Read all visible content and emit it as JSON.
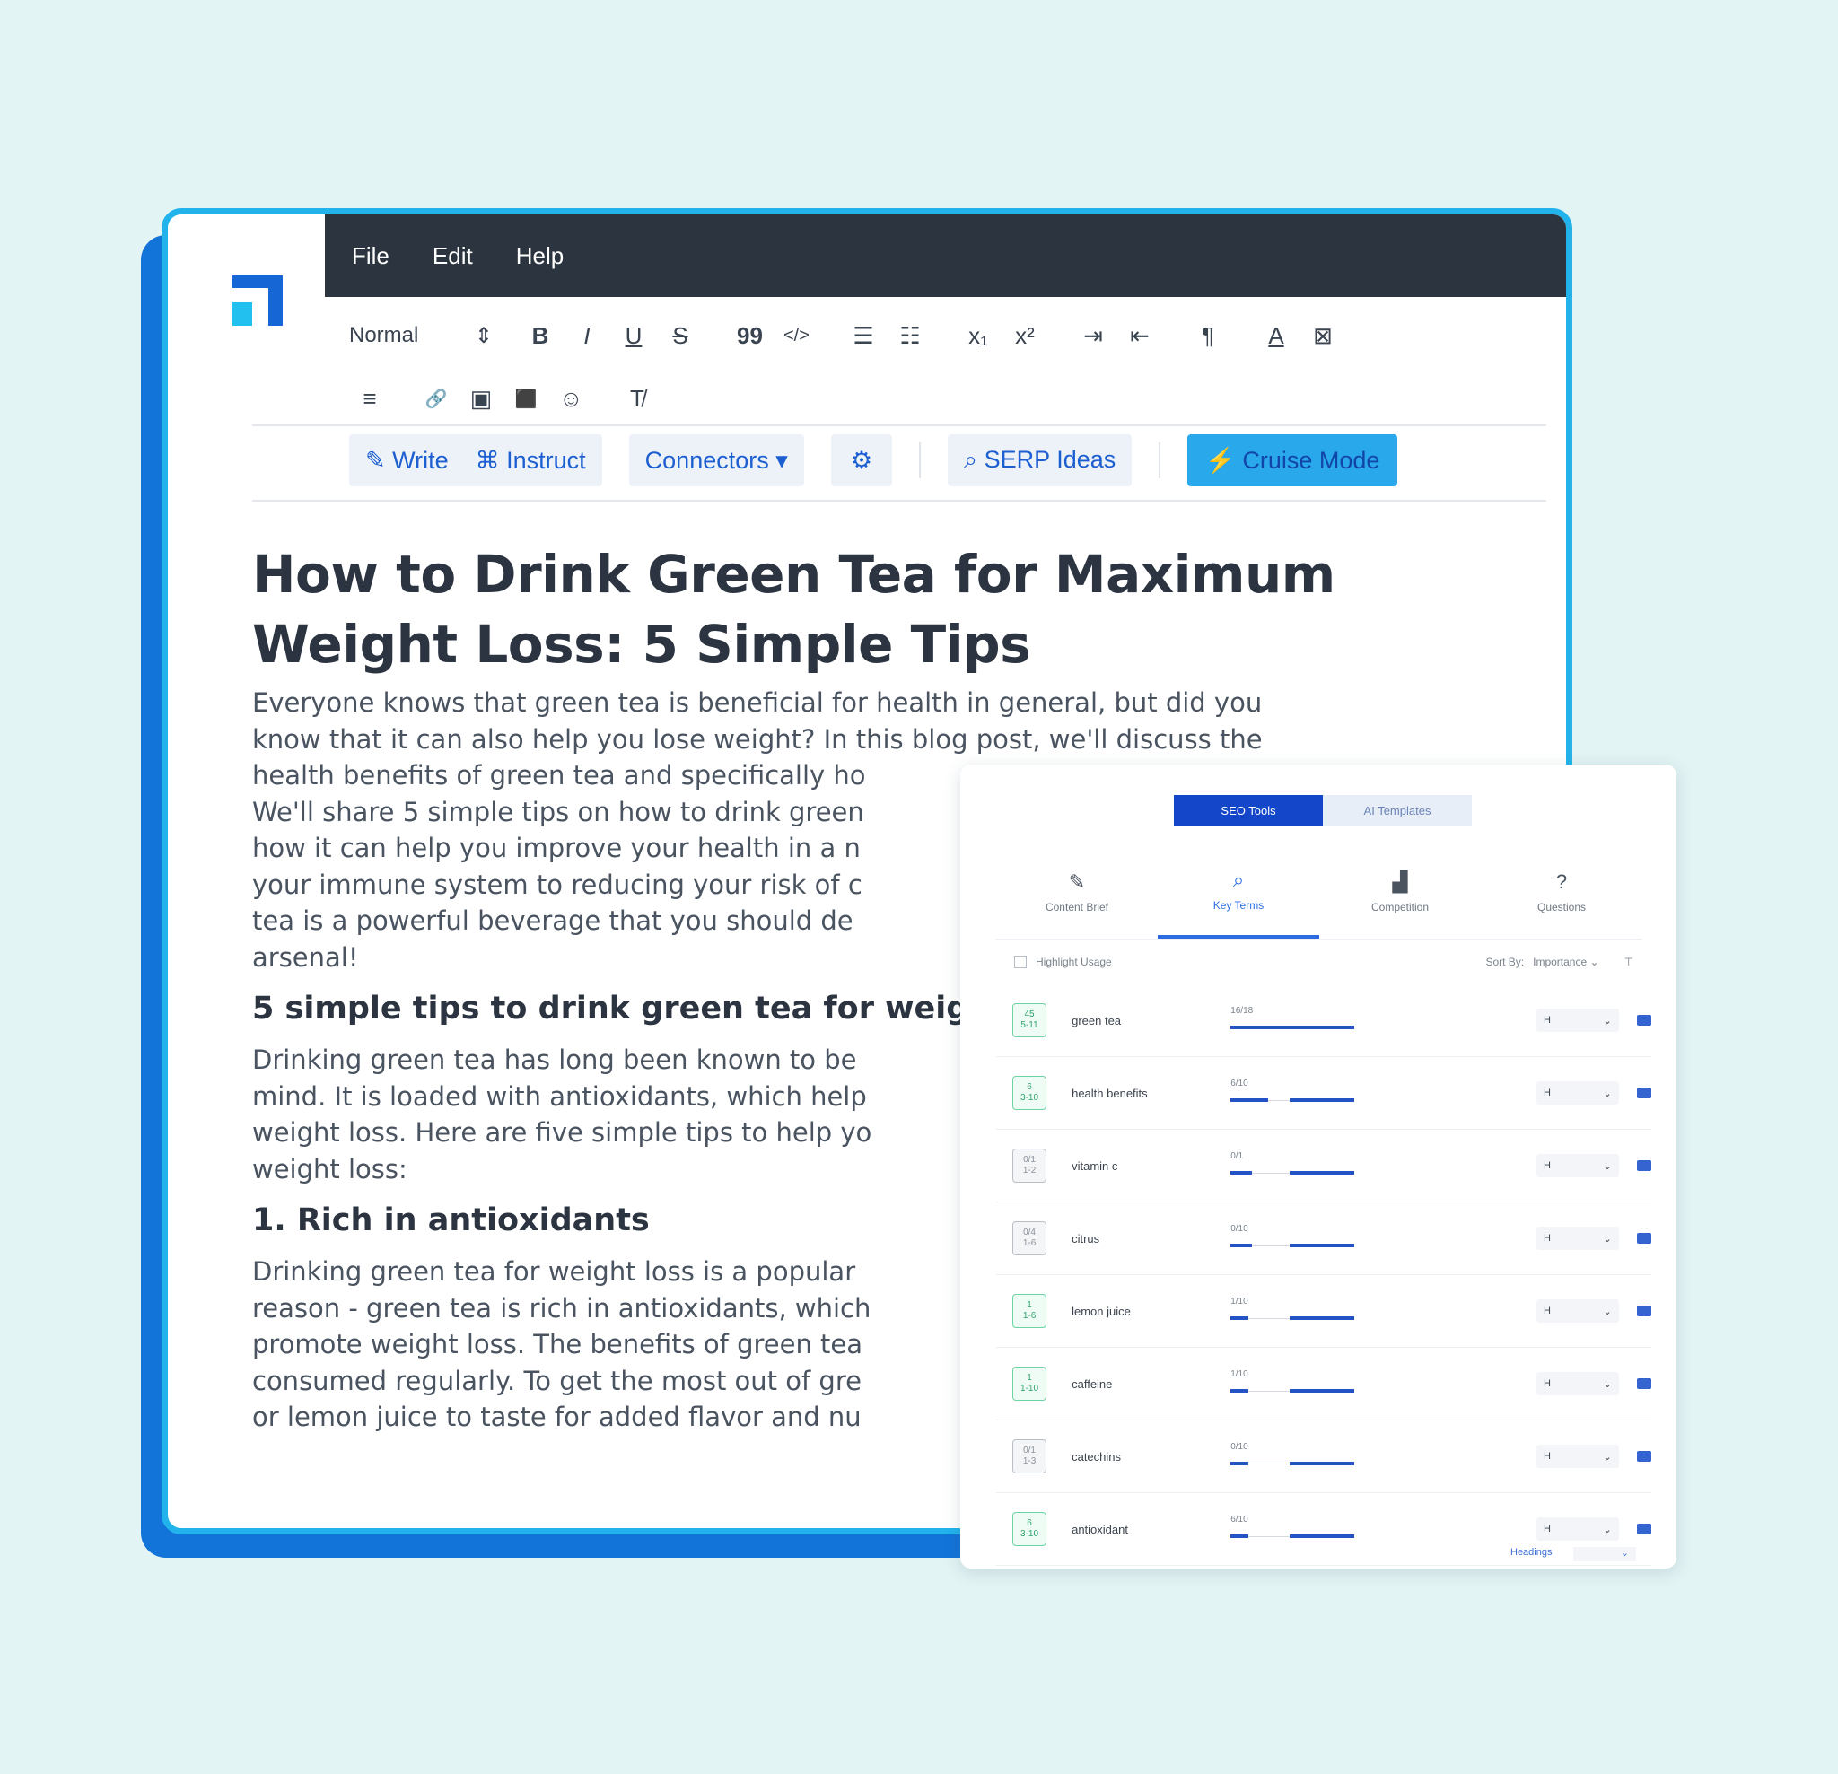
{
  "menu": [
    "File",
    "Edit",
    "Help"
  ],
  "toolbar": {
    "format_value": "Normal",
    "format_arrow": "⇕",
    "row1": [
      "B",
      "I",
      "U",
      "S",
      "99",
      "</>",
      "☰",
      "☷",
      "x₁",
      "x²",
      "⇥",
      "⇤",
      "¶",
      "A",
      "⊠"
    ],
    "row2": [
      "≡",
      "🔗",
      "▣",
      "⬛",
      "☺",
      "T̸"
    ]
  },
  "actions": {
    "write": "✎ Write",
    "instruct": "⌘ Instruct",
    "connectors": "Connectors  ▾",
    "settings": "⚙",
    "serp": "⌕ SERP Ideas",
    "cruise": "⚡ Cruise Mode"
  },
  "article": {
    "title": "How to Drink Green Tea for Maximum Weight Loss: 5 Simple Tips",
    "intro_lines": [
      "Everyone knows that green tea is beneficial for health in general, but did you",
      "know that it can also help you lose weight? In this blog post, we'll discuss the",
      "health benefits of green tea and specifically ho",
      "We'll share 5 simple tips on how to drink green",
      "how it can help you improve your health in a n",
      "your immune system to reducing your risk of c",
      "tea is a powerful beverage that you should de",
      "arsenal!"
    ],
    "h2": "5 simple tips to drink green tea for weig",
    "p2_lines": [
      "Drinking green tea has long been known to be",
      "mind. It is loaded with antioxidants, which help",
      "weight loss. Here are five simple tips to help yo",
      "weight loss:"
    ],
    "h3": "1. Rich in antioxidants",
    "p3_lines": [
      "Drinking green tea for weight loss is a popular",
      "reason - green tea is rich in antioxidants, which",
      "promote weight loss. The benefits of green tea",
      "consumed regularly. To get the most out of gre",
      "or lemon juice to taste for added flavor and nu"
    ]
  },
  "panel": {
    "segments": [
      "SEO Tools",
      "AI Templates"
    ],
    "tabs": [
      {
        "label": "Content Brief",
        "icon": "✎"
      },
      {
        "label": "Key Terms",
        "icon": "⌕"
      },
      {
        "label": "Competition",
        "icon": "▟"
      },
      {
        "label": "Questions",
        "icon": "?"
      }
    ],
    "highlight_label": "Highlight Usage",
    "sort_label": "Sort By:",
    "sort_value": "Importance  ⌄",
    "filter_icon": "⊤",
    "row_select_label": "H",
    "row_select_chevron": "⌄",
    "headings_label": "Headings",
    "rows": [
      {
        "score": "45",
        "range": "5-11",
        "term": "green tea",
        "count": "16/18",
        "fill": 1.0,
        "ok": true
      },
      {
        "score": "6",
        "range": "3-10",
        "term": "health benefits",
        "count": "6/10",
        "fill": 0.6,
        "ok": true
      },
      {
        "score": "0/1",
        "range": "1-2",
        "term": "vitamin c",
        "count": "0/1",
        "fill": 0.35,
        "ok": false
      },
      {
        "score": "0/4",
        "range": "1-6",
        "term": "citrus",
        "count": "0/10",
        "fill": 0.35,
        "ok": false
      },
      {
        "score": "1",
        "range": "1-6",
        "term": "lemon juice",
        "count": "1/10",
        "fill": 0.2,
        "ok": true
      },
      {
        "score": "1",
        "range": "1-10",
        "term": "caffeine",
        "count": "1/10",
        "fill": 0.2,
        "ok": true
      },
      {
        "score": "0/1",
        "range": "1-3",
        "term": "catechins",
        "count": "0/10",
        "fill": 0.2,
        "ok": false
      },
      {
        "score": "6",
        "range": "3-10",
        "term": "antioxidant",
        "count": "6/10",
        "fill": 0.2,
        "ok": true
      }
    ]
  }
}
